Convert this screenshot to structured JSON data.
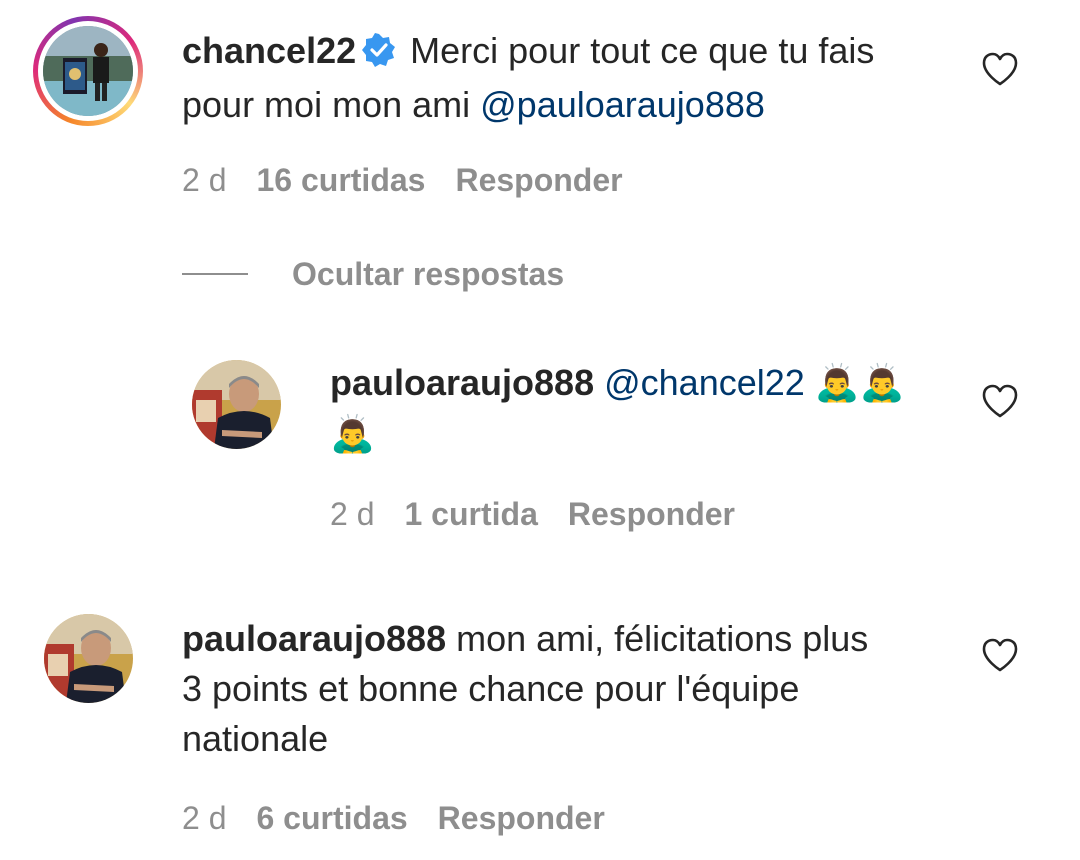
{
  "comments": [
    {
      "username": "chancel22",
      "verified": true,
      "text": "Merci pour tout ce que tu fais",
      "text_line2": "pour moi mon ami",
      "mention": "@pauloaraujo888",
      "time": "2 d",
      "likes": "16 curtidas",
      "reply": "Responder",
      "has_story_ring": true
    },
    {
      "username": "pauloaraujo888",
      "mention": "@chancel22",
      "emoji_line1": "🙇‍♂️🙇‍♂️",
      "emoji_line2": "🙇‍♂️",
      "time": "2 d",
      "likes": "1 curtida",
      "reply": "Responder"
    },
    {
      "username": "pauloaraujo888",
      "text_line1": "mon ami, félicitations plus",
      "text_line2": "3 points et bonne chance pour l'équipe",
      "text_line3": "nationale",
      "time": "2 d",
      "likes": "6 curtidas",
      "reply": "Responder"
    }
  ],
  "hide_replies_label": "Ocultar respostas",
  "icons": {
    "verified": "verified-badge-icon",
    "like": "heart-icon"
  },
  "colors": {
    "text": "#262626",
    "secondary": "#8e8e8e",
    "mention": "#00376b",
    "verified": "#3897f0"
  }
}
